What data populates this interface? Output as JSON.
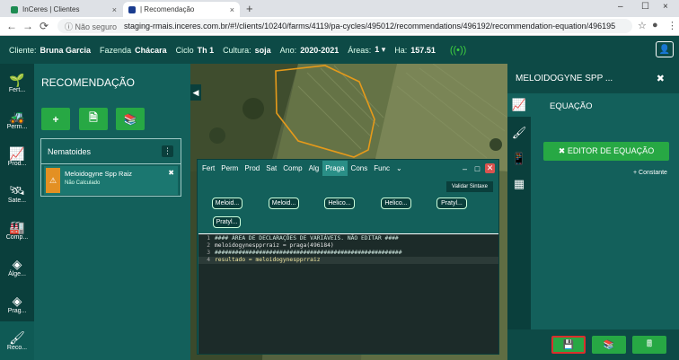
{
  "browser": {
    "tabs": [
      {
        "label": "InCeres | Clientes",
        "close": "×",
        "active": false
      },
      {
        "label": "| Recomendação",
        "close": "×",
        "active": true
      }
    ],
    "new_tab": "+",
    "window_controls": [
      "–",
      "☐",
      "×"
    ],
    "nav": {
      "back": "←",
      "forward": "→",
      "reload": "⟳"
    },
    "security": "ⓘ Não seguro",
    "url": "staging-rmais.inceres.com.br/#!/clients/10240/farms/4119/pa-cycles/495012/recommendations/496192/recommendation-equation/496195",
    "right_icons": [
      "☆",
      "●",
      "⋮"
    ]
  },
  "header": {
    "cliente_label": "Cliente:",
    "cliente": "Bruna Garcia",
    "fazenda_label": "Fazenda",
    "fazenda": "Chácara",
    "ciclo_label": "Ciclo",
    "ciclo": "Th 1",
    "cultura_label": "Cultura:",
    "cultura": "soja",
    "ano_label": "Ano:",
    "ano": "2020-2021",
    "areas_label": "Áreas:",
    "areas": "1 ▾",
    "ha_label": "Ha:",
    "ha": "157.51",
    "wifi": "((•))",
    "user": "👤"
  },
  "rail": [
    {
      "icon": "🌱",
      "label": "Fert..."
    },
    {
      "icon": "🚜",
      "label": "Perm..."
    },
    {
      "icon": "📈",
      "label": "Prod..."
    },
    {
      "icon": "🛰",
      "label": "Sate..."
    },
    {
      "icon": "🏭",
      "label": "Comp..."
    },
    {
      "icon": "◈",
      "label": "Álge..."
    },
    {
      "icon": "◈",
      "label": "Prag..."
    },
    {
      "icon": "🖌",
      "label": "Reco..."
    }
  ],
  "recommendation": {
    "title": "RECOMENDAÇÃO",
    "buttons": [
      "+",
      "🗎",
      "📚"
    ],
    "card_title": "Nematoides",
    "card_menu": "⋮",
    "item_name": "Meloidogyne Spp Raiz",
    "item_status": "Não Calculado",
    "item_warning": "⚠",
    "item_close": "✖"
  },
  "map": {
    "toggle": "◀"
  },
  "editor": {
    "tabs": [
      "Fert",
      "Perm",
      "Prod",
      "Sat",
      "Comp",
      "Alg",
      "Praga",
      "Cons",
      "Func",
      "⌄"
    ],
    "active_tab": "Praga",
    "window_buttons": [
      "–",
      "□",
      "✕"
    ],
    "validar": "Validar Sintaxe",
    "chips": [
      "Meloid...",
      "Meloid...",
      "Helico...",
      "Helico...",
      "Pratyl...",
      "Pratyl..."
    ],
    "code": [
      {
        "n": "1",
        "text": "#### ÁREA DE DECLARAÇÕES DE VARIÁVEIS. NÃO EDITAR ####"
      },
      {
        "n": "2",
        "text": "meloidogynespprraiz = praga(496184)"
      },
      {
        "n": "3",
        "text": "#######################################################"
      },
      {
        "n": "4",
        "text": "resultado = meloidogynespprraiz"
      }
    ]
  },
  "right_panel": {
    "title": "MELOIDOGYNE SPP ...",
    "close": "✖",
    "rail_icons": [
      "📈",
      "🖌",
      "📱",
      "▦"
    ],
    "section": "EQUAÇÃO",
    "editor_button": "✖ EDITOR DE EQUAÇÃO",
    "constante": "+ Constante",
    "bottom_buttons": [
      "💾",
      "📚",
      "🖩"
    ]
  }
}
